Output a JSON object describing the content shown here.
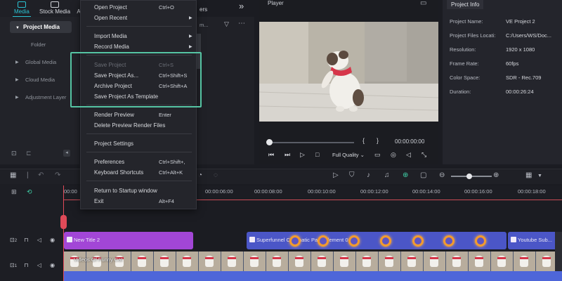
{
  "media_tabs": [
    {
      "label": "Media",
      "active": true
    },
    {
      "label": "Stock Media",
      "active": false
    },
    {
      "label": "A",
      "active": false
    }
  ],
  "behind_menu_tab_fragment": "ers",
  "left_panel": {
    "project_media": "Project Media",
    "items": [
      "Folder",
      "Global Media",
      "Cloud Media",
      "Adjustment Layer"
    ]
  },
  "search_fragment": "m...",
  "player": {
    "title": "Player",
    "time": "00:00:00:00",
    "quality": "Full Quality"
  },
  "project_info": {
    "tab": "Project Info",
    "rows": [
      {
        "key": "Project Name:",
        "value": "VE Project 2"
      },
      {
        "key": "Project Files Locati:",
        "value": "C:/Users/WS/Doc..."
      },
      {
        "key": "Resolution:",
        "value": "1920 x 1080"
      },
      {
        "key": "Frame Rate:",
        "value": "60fps"
      },
      {
        "key": "Color Space:",
        "value": "SDR - Rec.709"
      },
      {
        "key": "Duration:",
        "value": "00:00:26:24"
      }
    ]
  },
  "menu": {
    "items": [
      {
        "label": "Open Project",
        "shortcut": "Ctrl+O",
        "disabled": false
      },
      {
        "label": "Open Recent",
        "shortcut": "",
        "submenu": true,
        "disabled": false
      },
      {
        "label": "Import Media",
        "shortcut": "",
        "submenu": true,
        "disabled": false
      },
      {
        "label": "Record Media",
        "shortcut": "",
        "submenu": true,
        "disabled": false
      },
      {
        "label": "Save Project",
        "shortcut": "Ctrl+S",
        "disabled": true
      },
      {
        "label": "Save Project As...",
        "shortcut": "Ctrl+Shift+S",
        "disabled": false
      },
      {
        "label": "Archive Project",
        "shortcut": "Ctrl+Shift+A",
        "disabled": false
      },
      {
        "label": "Save Project As Template",
        "shortcut": "",
        "disabled": false
      },
      {
        "label": "Render Preview",
        "shortcut": "Enter",
        "disabled": false
      },
      {
        "label": "Delete Preview Render Files",
        "shortcut": "",
        "disabled": false
      },
      {
        "label": "Project Settings",
        "shortcut": "",
        "disabled": false
      },
      {
        "label": "Preferences",
        "shortcut": "Ctrl+Shift+,",
        "disabled": false
      },
      {
        "label": "Keyboard Shortcuts",
        "shortcut": "Ctrl+Alt+K",
        "disabled": false
      },
      {
        "label": "Return to Startup window",
        "shortcut": "",
        "disabled": false
      },
      {
        "label": "Exit",
        "shortcut": "Alt+F4",
        "disabled": false
      }
    ]
  },
  "ruler": {
    "ticks": [
      "00:00",
      "00:00:06:00",
      "00:00:08:00",
      "00:00:10:00",
      "00:00:12:00",
      "00:00:14:00",
      "00:00:16:00",
      "00:00:18:00"
    ]
  },
  "tracks": [
    {
      "num": "2"
    },
    {
      "num": "1"
    }
  ],
  "clips": {
    "title": "New Title 2",
    "effect": "Superfunnel Cinematic Pack Element 01",
    "youtube": "Youtube Sub...",
    "video": "Videos Of Funny Cat"
  },
  "colors": {
    "accent": "#2ac3d3",
    "highlight_box": "#55c4a3",
    "title_clip": "#a246d6",
    "effect_clip": "#4b56c7",
    "playhead": "#e04a58"
  }
}
